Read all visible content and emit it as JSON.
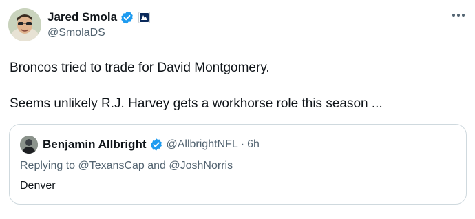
{
  "author": {
    "name": "Jared Smola",
    "handle": "@SmolaDS",
    "verified_icon": "verified-badge-icon",
    "affiliation_icon": "affiliate-badge-icon"
  },
  "more_icon": "more-options-icon",
  "tweet": {
    "line1": "Broncos tried to trade for David Montgomery.",
    "line2": "Seems unlikely R.J. Harvey gets a workhorse role this season ..."
  },
  "quote": {
    "name": "Benjamin Allbright",
    "handle": "@AllbrightNFL",
    "separator": "·",
    "time": "6h",
    "reply_prefix": "Replying to ",
    "reply_user1": "@TexansCap",
    "reply_and": " and ",
    "reply_user2": "@JoshNorris",
    "text": "Denver"
  },
  "colors": {
    "verified_blue": "#1d9bf0",
    "secondary_text": "#536471",
    "border": "#cfd9de",
    "affiliate_navy": "#0b2a5b"
  }
}
